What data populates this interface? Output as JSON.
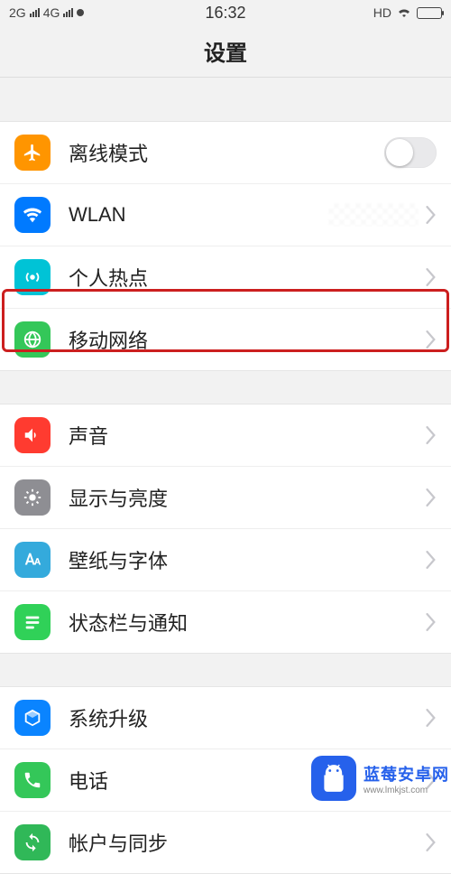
{
  "status": {
    "left_net1": "2G",
    "left_net2": "4G",
    "time": "16:32",
    "right_hd": "HD"
  },
  "header": {
    "title": "设置"
  },
  "rows": {
    "airplane": {
      "label": "离线模式"
    },
    "wlan": {
      "label": "WLAN"
    },
    "hotspot": {
      "label": "个人热点"
    },
    "mobile": {
      "label": "移动网络"
    },
    "sound": {
      "label": "声音"
    },
    "display": {
      "label": "显示与亮度"
    },
    "wallpaper": {
      "label": "壁纸与字体"
    },
    "statusbar": {
      "label": "状态栏与通知"
    },
    "update": {
      "label": "系统升级"
    },
    "phone": {
      "label": "电话"
    },
    "accounts": {
      "label": "帐户与同步"
    }
  },
  "icons": {
    "airplane": "airplane-icon",
    "wlan": "wifi-icon",
    "hotspot": "hotspot-icon",
    "mobile": "globe-icon",
    "sound": "speaker-icon",
    "display": "brightness-icon",
    "wallpaper": "font-icon",
    "statusbar": "list-icon",
    "update": "cube-icon",
    "phone": "phone-icon",
    "accounts": "sync-icon"
  },
  "colors": {
    "airplane": "#ff9500",
    "wlan": "#007aff",
    "hotspot": "#00c3d6",
    "mobile": "#34c759",
    "sound": "#ff3b30",
    "display": "#8e8e93",
    "wallpaper": "#34aadc",
    "statusbar": "#30d158",
    "update": "#0a84ff",
    "phone": "#34c759",
    "accounts": "#30b858"
  },
  "watermark": {
    "title": "蓝莓安卓网",
    "url": "www.lmkjst.com"
  }
}
